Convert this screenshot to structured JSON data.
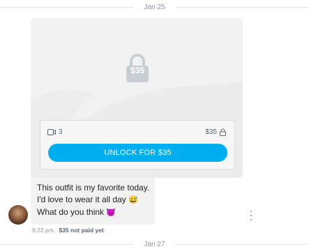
{
  "dates": {
    "top": "Jan 25",
    "bottom": "Jan 27"
  },
  "locked_post": {
    "price_badge": "$35",
    "media_count": "3",
    "price": "$35",
    "unlock_label": "UNLOCK FOR $35"
  },
  "message": {
    "lines": [
      "This outfit is my favorite today.",
      "I'd love to wear it all day",
      "What do you think"
    ],
    "emoji_1": "😅",
    "emoji_2": "😈"
  },
  "meta": {
    "time": "9:22 pm,",
    "status": "$35 not paid yet"
  },
  "colors": {
    "accent": "#00aff0",
    "card": "#f2f2f2",
    "muted": "#8a96a3"
  },
  "icons": [
    "lock-icon",
    "video-icon",
    "more-icon"
  ]
}
